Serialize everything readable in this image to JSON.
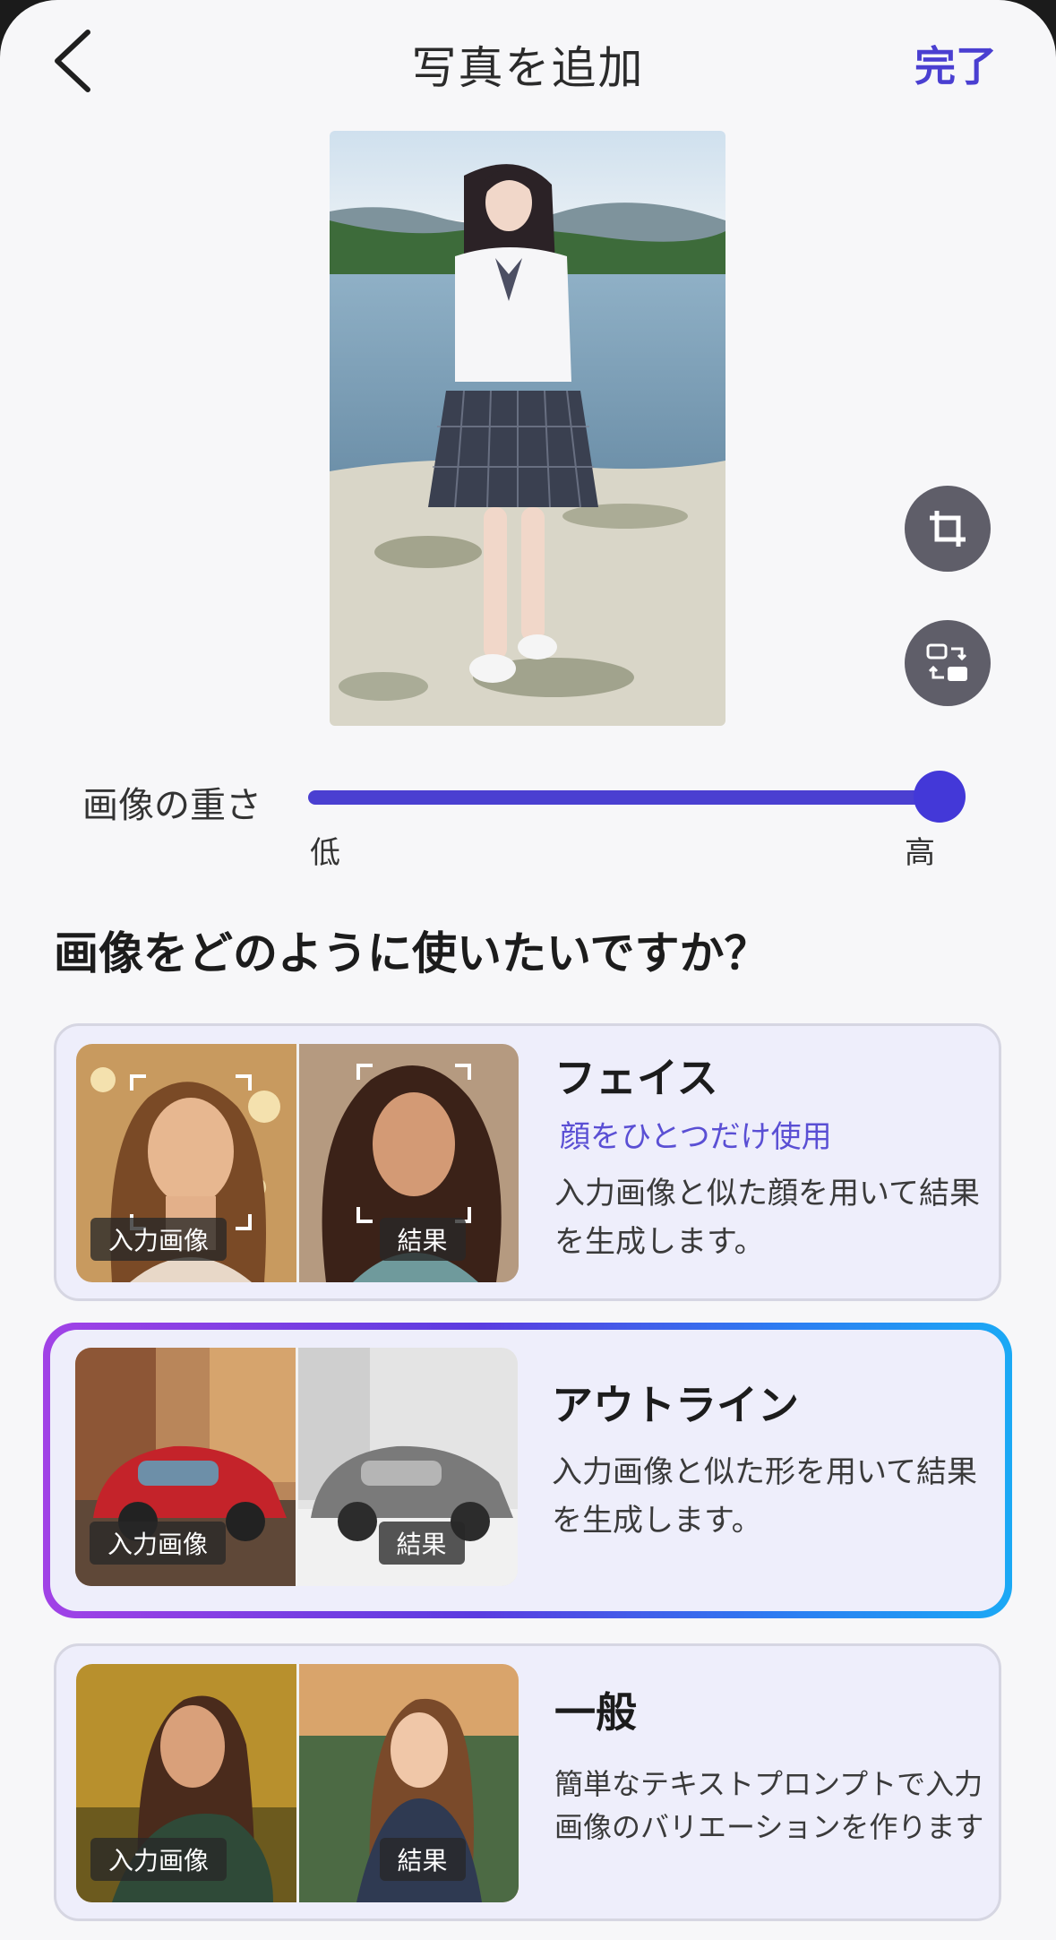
{
  "header": {
    "title": "写真を追加",
    "done_label": "完了"
  },
  "slider": {
    "label": "画像の重さ",
    "min_label": "低",
    "max_label": "高",
    "value_fraction": 1.0
  },
  "question": "画像をどのように使いたいですか？",
  "cards": [
    {
      "title": "フェイス",
      "subtitle": "顔をひとつだけ使用",
      "description": "入力画像と似た顔を用いて結果を生成します。",
      "input_tag": "入力画像",
      "result_tag": "結果",
      "selected": false
    },
    {
      "title": "アウトライン",
      "description": "入力画像と似た形を用いて結果を生成します。",
      "input_tag": "入力画像",
      "result_tag": "結果",
      "selected": true
    },
    {
      "title": "一般",
      "description": "簡単なテキストプロンプトで入力画像のバリエーションを作ります",
      "input_tag": "入力画像",
      "result_tag": "結果",
      "selected": false
    }
  ],
  "icons": {
    "back": "chevron-left-icon",
    "crop": "crop-icon",
    "swap": "swap-image-icon"
  },
  "colors": {
    "accent": "#4a3fd1",
    "selected_gradient_start": "#a142e6",
    "selected_gradient_end": "#1ba9f5"
  }
}
